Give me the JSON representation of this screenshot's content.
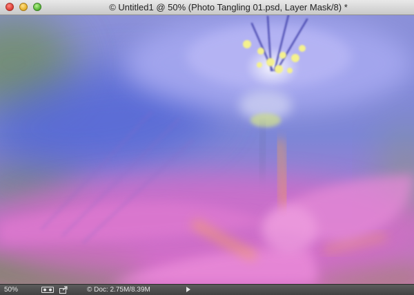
{
  "window": {
    "title": "© Untitled1 @ 50% (Photo Tangling 01.psd, Layer Mask/8) *"
  },
  "statusbar": {
    "zoom": "50%",
    "doc_info": "© Doc: 2.75M/8.39M"
  },
  "icons": {
    "close": "close-dot-icon",
    "minimize": "minimize-dot-icon",
    "zoom": "zoom-dot-icon",
    "info": "document-info-icon",
    "share": "share-icon",
    "menu": "disclosure-arrow-icon"
  },
  "colors": {
    "titlebar": "#d6d6d6",
    "statusbar": "#4a4a4a",
    "flower_blue": "#7f86e0",
    "flower_pink": "#e070c8",
    "stamen_yellow": "#f2f08a"
  }
}
